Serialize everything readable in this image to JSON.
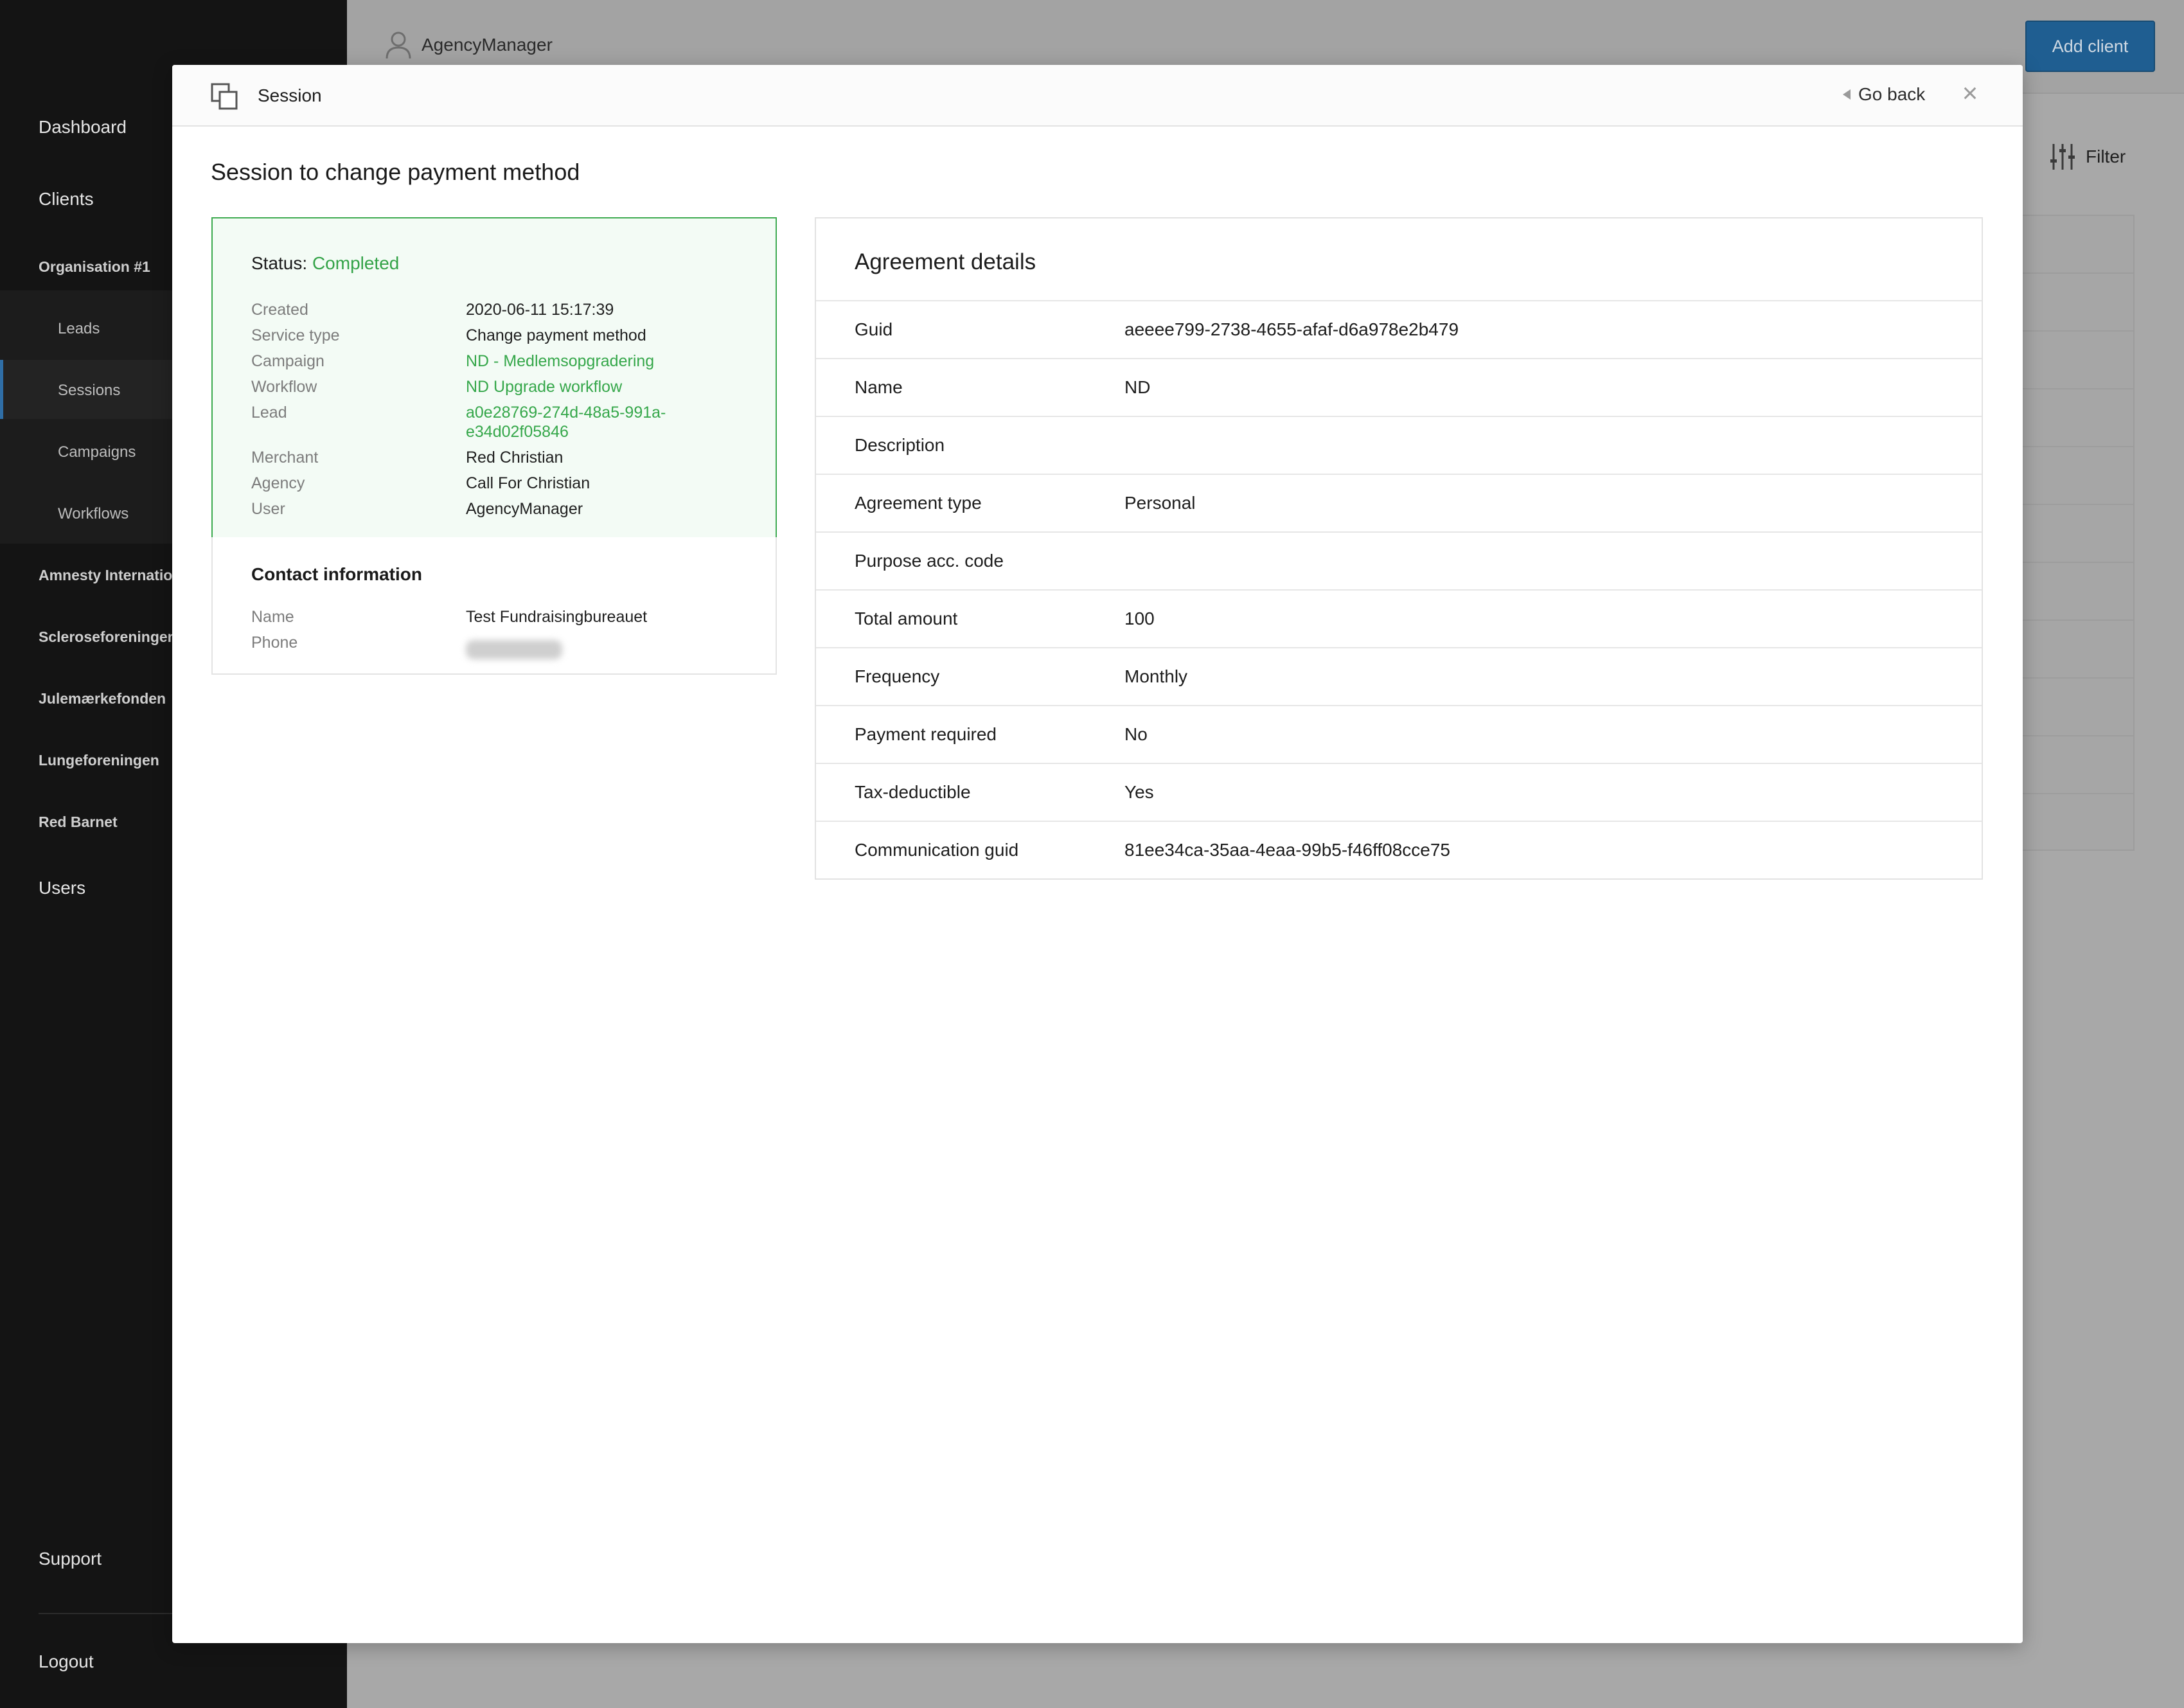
{
  "sidebar": {
    "items": [
      {
        "label": "Dashboard"
      },
      {
        "label": "Clients"
      },
      {
        "label": "Organisation #1"
      },
      {
        "label": "Leads"
      },
      {
        "label": "Sessions"
      },
      {
        "label": "Campaigns"
      },
      {
        "label": "Workflows"
      },
      {
        "label": "Amnesty International"
      },
      {
        "label": "Scleroseforeningen"
      },
      {
        "label": "Julemærkefonden"
      },
      {
        "label": "Lungeforeningen"
      },
      {
        "label": "Red Barnet"
      },
      {
        "label": "Users"
      }
    ],
    "support": "Support",
    "logout": "Logout",
    "active_item": "Sessions",
    "accent_color": "#2f6ea6"
  },
  "topbar": {
    "user": "AgencyManager",
    "add_client": "Add client",
    "filter": "Filter"
  },
  "modal": {
    "title": "Session",
    "go_back": "Go back",
    "close": "×",
    "heading": "Session to change payment method"
  },
  "status": {
    "label": "Status:",
    "value": "Completed",
    "color": "#34a348",
    "fields": [
      {
        "label": "Created",
        "value": "2020-06-11 15:17:39"
      },
      {
        "label": "Service type",
        "value": "Change payment method"
      },
      {
        "label": "Campaign",
        "value": "ND - Medlemsopgradering"
      },
      {
        "label": "Workflow",
        "value": "ND Upgrade workflow"
      },
      {
        "label": "Lead",
        "value_line1": "a0e28769-274d-48a5-991a-",
        "value_line2": "e34d02f05846"
      },
      {
        "label": "Merchant",
        "value": "Red Christian"
      },
      {
        "label": "Agency",
        "value": "Call For Christian"
      },
      {
        "label": "User",
        "value": "AgencyManager"
      }
    ]
  },
  "contact": {
    "title": "Contact information",
    "fields": [
      {
        "label": "Name",
        "value": "Test Fundraisingbureauet"
      },
      {
        "label": "Phone",
        "value": ""
      }
    ]
  },
  "agreement": {
    "title": "Agreement details",
    "rows": [
      {
        "label": "Guid",
        "value": "aeeee799-2738-4655-afaf-d6a978e2b479"
      },
      {
        "label": "Name",
        "value": "ND"
      },
      {
        "label": "Description",
        "value": ""
      },
      {
        "label": "Agreement type",
        "value": "Personal"
      },
      {
        "label": "Purpose acc. code",
        "value": ""
      },
      {
        "label": "Total amount",
        "value": "100"
      },
      {
        "label": "Frequency",
        "value": "Monthly"
      },
      {
        "label": "Payment required",
        "value": "No"
      },
      {
        "label": "Tax-deductible",
        "value": "Yes"
      },
      {
        "label": "Communication guid",
        "value": "81ee34ca-35aa-4eaa-99b5-f46ff08cce75"
      }
    ]
  }
}
